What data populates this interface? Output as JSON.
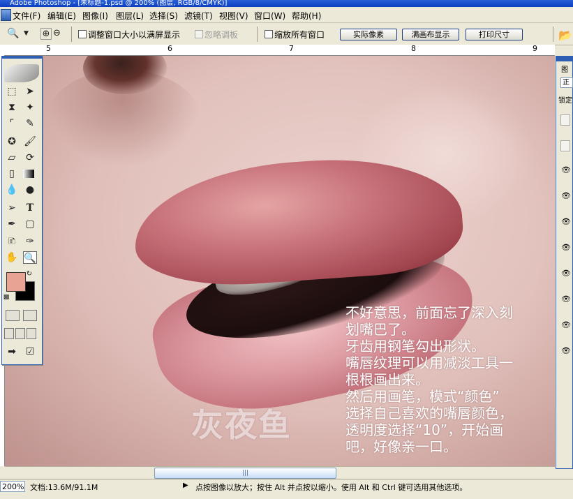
{
  "window": {
    "title": "Adobe Photoshop - [未标题-1.psd @ 200% (图层, RGB/8/CMYK)]"
  },
  "menu": [
    "文件(F)",
    "编辑(E)",
    "图像(I)",
    "图层(L)",
    "选择(S)",
    "滤镜(T)",
    "视图(V)",
    "窗口(W)",
    "帮助(H)"
  ],
  "options": {
    "resize_windows": "调整窗口大小以满屏显示",
    "ignore_palettes": "忽略调板",
    "zoom_all": "缩放所有窗口",
    "actual_pixels": "实际像素",
    "fit_on_screen": "满画布显示",
    "print_size": "打印尺寸"
  },
  "ruler": {
    "marks": [
      "5",
      "6",
      "7",
      "8",
      "9"
    ]
  },
  "canvas": {
    "tutorial_text": "不好意思，前面忘了深入刻\n划嘴巴了。\n牙齿用钢笔勾出形状。\n嘴唇纹理可以用减淡工具一\n根根画出来。\n然后用画笔，模式“颜色”\n选择自己喜欢的嘴唇颜色，\n透明度选择“10”，开始画\n吧，好像亲一口。",
    "watermark": "灰夜鱼"
  },
  "status": {
    "zoom": "200%",
    "doc_size": "文档:13.6M/91.1M",
    "hint": "点按图像以放大；按住 Alt 并点按以缩小。使用 Alt 和 Ctrl 键可选用其他选项。"
  },
  "toolbox": {
    "foreground_color": "#e8a394",
    "background_color": "#000000",
    "tools": [
      "marquee-icon",
      "move-icon",
      "lasso-icon",
      "magic-wand-icon",
      "crop-icon",
      "slice-icon",
      "healing-brush-icon",
      "brush-icon",
      "clone-stamp-icon",
      "history-brush-icon",
      "eraser-icon",
      "gradient-icon",
      "blur-icon",
      "dodge-icon",
      "path-selection-icon",
      "type-icon",
      "pen-icon",
      "shape-icon",
      "notes-icon",
      "eyedropper-icon",
      "hand-icon",
      "zoom-icon"
    ]
  },
  "layers_panel": {
    "tab": "图",
    "mode": "正",
    "lock": "锁定",
    "visible_rows": 7
  }
}
